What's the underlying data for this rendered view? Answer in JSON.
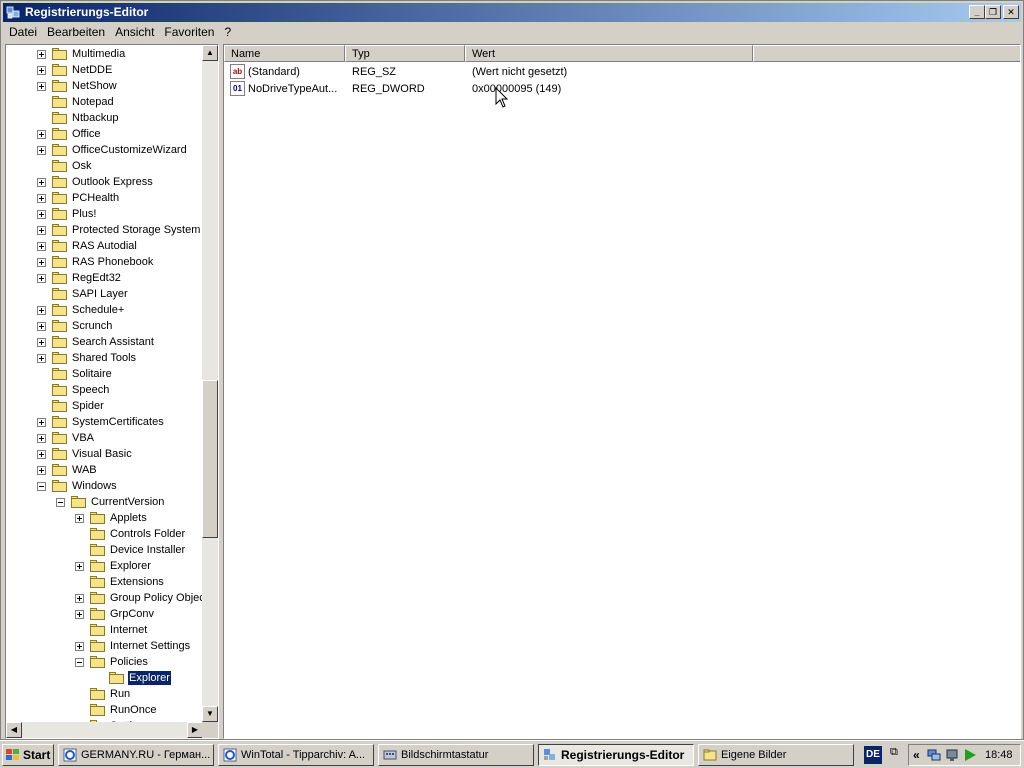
{
  "window": {
    "title": "Registrierungs-Editor"
  },
  "menu": [
    "Datei",
    "Bearbeiten",
    "Ansicht",
    "Favoriten",
    "?"
  ],
  "tree": [
    {
      "label": "Multimedia",
      "level": 0,
      "expander": "plus"
    },
    {
      "label": "NetDDE",
      "level": 0,
      "expander": "plus"
    },
    {
      "label": "NetShow",
      "level": 0,
      "expander": "plus"
    },
    {
      "label": "Notepad",
      "level": 0,
      "expander": "none"
    },
    {
      "label": "Ntbackup",
      "level": 0,
      "expander": "none"
    },
    {
      "label": "Office",
      "level": 0,
      "expander": "plus"
    },
    {
      "label": "OfficeCustomizeWizard",
      "level": 0,
      "expander": "plus"
    },
    {
      "label": "Osk",
      "level": 0,
      "expander": "none"
    },
    {
      "label": "Outlook Express",
      "level": 0,
      "expander": "plus"
    },
    {
      "label": "PCHealth",
      "level": 0,
      "expander": "plus"
    },
    {
      "label": "Plus!",
      "level": 0,
      "expander": "plus"
    },
    {
      "label": "Protected Storage System",
      "level": 0,
      "expander": "plus"
    },
    {
      "label": "RAS Autodial",
      "level": 0,
      "expander": "plus"
    },
    {
      "label": "RAS Phonebook",
      "level": 0,
      "expander": "plus"
    },
    {
      "label": "RegEdt32",
      "level": 0,
      "expander": "plus"
    },
    {
      "label": "SAPI Layer",
      "level": 0,
      "expander": "none"
    },
    {
      "label": "Schedule+",
      "level": 0,
      "expander": "plus"
    },
    {
      "label": "Scrunch",
      "level": 0,
      "expander": "plus"
    },
    {
      "label": "Search Assistant",
      "level": 0,
      "expander": "plus"
    },
    {
      "label": "Shared Tools",
      "level": 0,
      "expander": "plus"
    },
    {
      "label": "Solitaire",
      "level": 0,
      "expander": "none"
    },
    {
      "label": "Speech",
      "level": 0,
      "expander": "none"
    },
    {
      "label": "Spider",
      "level": 0,
      "expander": "none"
    },
    {
      "label": "SystemCertificates",
      "level": 0,
      "expander": "plus"
    },
    {
      "label": "VBA",
      "level": 0,
      "expander": "plus"
    },
    {
      "label": "Visual Basic",
      "level": 0,
      "expander": "plus"
    },
    {
      "label": "WAB",
      "level": 0,
      "expander": "plus"
    },
    {
      "label": "Windows",
      "level": 0,
      "expander": "minus"
    },
    {
      "label": "CurrentVersion",
      "level": 1,
      "expander": "minus"
    },
    {
      "label": "Applets",
      "level": 2,
      "expander": "plus"
    },
    {
      "label": "Controls Folder",
      "level": 2,
      "expander": "none"
    },
    {
      "label": "Device Installer",
      "level": 2,
      "expander": "none"
    },
    {
      "label": "Explorer",
      "level": 2,
      "expander": "plus"
    },
    {
      "label": "Extensions",
      "level": 2,
      "expander": "none"
    },
    {
      "label": "Group Policy Objects",
      "level": 2,
      "expander": "plus"
    },
    {
      "label": "GrpConv",
      "level": 2,
      "expander": "plus"
    },
    {
      "label": "Internet",
      "level": 2,
      "expander": "none"
    },
    {
      "label": "Internet Settings",
      "level": 2,
      "expander": "plus"
    },
    {
      "label": "Policies",
      "level": 2,
      "expander": "minus"
    },
    {
      "label": "Explorer",
      "level": 3,
      "expander": "none",
      "selected": true
    },
    {
      "label": "Run",
      "level": 2,
      "expander": "none"
    },
    {
      "label": "RunOnce",
      "level": 2,
      "expander": "none"
    },
    {
      "label": "Settings",
      "level": 2,
      "expander": "plus"
    }
  ],
  "list": {
    "columns": [
      "Name",
      "Typ",
      "Wert"
    ],
    "rows": [
      {
        "icon": "ab",
        "name": "(Standard)",
        "type": "REG_SZ",
        "value": "(Wert nicht gesetzt)"
      },
      {
        "icon": "bin",
        "name": "NoDriveTypeAut...",
        "type": "REG_DWORD",
        "value": "0x00000095 (149)"
      }
    ]
  },
  "taskbar": {
    "start": "Start",
    "buttons": [
      {
        "label": "GERMANY.RU - Герман...",
        "icon": "ie-icon",
        "active": false
      },
      {
        "label": "WinTotal - Tipparchiv: A...",
        "icon": "ie-icon",
        "active": false
      },
      {
        "label": "Bildschirmtastatur",
        "icon": "keyboard-icon",
        "active": false
      },
      {
        "label": "Registrierungs-Editor",
        "icon": "regedit-icon",
        "active": true
      },
      {
        "label": "Eigene Bilder",
        "icon": "folder-icon",
        "active": false
      }
    ],
    "language": "DE",
    "clock": "18:48"
  }
}
